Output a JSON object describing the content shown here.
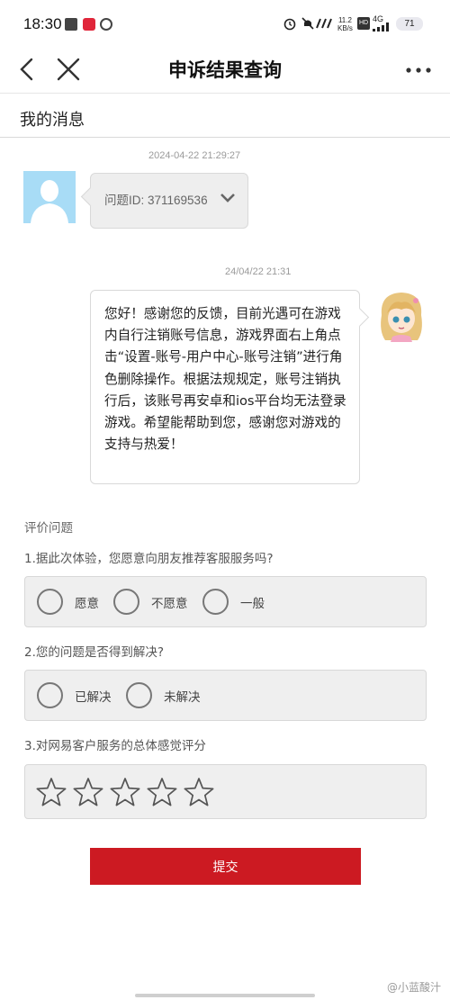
{
  "status_bar": {
    "time": "18:30",
    "network_speed_value": "11.2",
    "network_speed_unit": "KB/s",
    "hd_label": "HD",
    "signal_label": "4G",
    "battery": "71",
    "icons": [
      "mail-icon",
      "app-notification-icon",
      "vpn-icon",
      "alarm-icon",
      "mute-icon",
      "nfc-icon",
      "hd-icon",
      "signal-icon",
      "wifi-icon",
      "battery-icon"
    ]
  },
  "header": {
    "title": "申诉结果查询",
    "icons": [
      "back-icon",
      "close-icon",
      "more-icon"
    ]
  },
  "section": {
    "title": "我的消息"
  },
  "messages": [
    {
      "from": "user",
      "timestamp": "2024-04-22 21:29:27",
      "text": "问题ID: 371169536",
      "icon": "chevron-down-icon"
    },
    {
      "from": "agent",
      "timestamp": "24/04/22 21:31",
      "text": "您好！感谢您的反馈，目前光遇可在游戏内自行注销账号信息，游戏界面右上角点击“设置-账号-用户中心-账号注销”进行角色删除操作。根据法规规定，账号注销执行后，该账号再安卓和ios平台均无法登录游戏。希望能帮助到您，感谢您对游戏的支持与热爱！"
    }
  ],
  "evaluation": {
    "title": "评价问题",
    "q1": {
      "label": "1.据此次体验，您愿意向朋友推荐客服服务吗?",
      "options": [
        "愿意",
        "不愿意",
        "一般"
      ]
    },
    "q2": {
      "label": "2.您的问题是否得到解决?",
      "options": [
        "已解决",
        "未解决"
      ]
    },
    "q3": {
      "label": "3.对网易客户服务的总体感觉评分",
      "rating": 0,
      "max_rating": 5
    }
  },
  "submit_label": "提交",
  "watermark": "@小蓝酸汁",
  "colors": {
    "accent": "#cc1a22",
    "avatar_bg": "#a8dcf6",
    "bubble_bg": "#eeeeee"
  }
}
